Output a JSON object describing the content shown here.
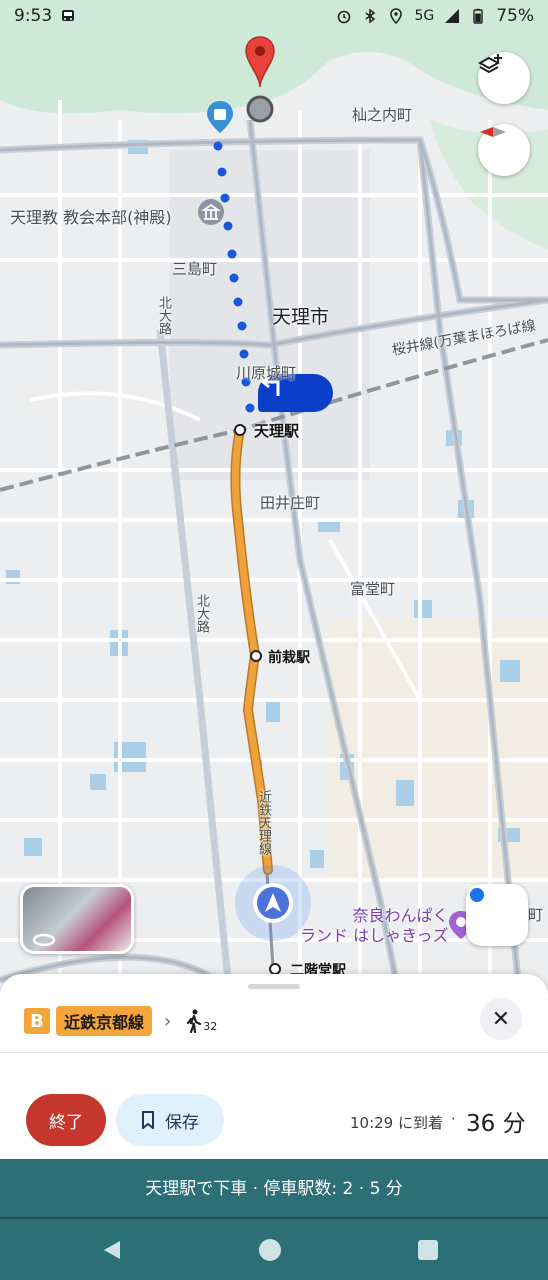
{
  "status_bar": {
    "time": "9:53",
    "network": "5G",
    "battery": "75%"
  },
  "map": {
    "labels": {
      "soma": "杣之内町",
      "tenrikyo": "天理教 教会本部(神殿)",
      "mishima": "三島町",
      "tenri_city": "天理市",
      "kitaoji_1": "北大路",
      "kawaharajo": "川原城町",
      "sakurai_line": "桜井線(万葉まほろば線",
      "tenri_station": "天理駅",
      "tainosho": "田井庄町",
      "tomido": "富堂町",
      "kitaoji_2": "北大路",
      "senzai_station": "前栽駅",
      "kintetsu_tenri_line": "近鉄天理線",
      "nara_wanpaku": "奈良わんぱく\nランド はしゃきっズ",
      "nikaido_station": "二階堂駅",
      "edge_cho": "町"
    }
  },
  "sheet": {
    "line_letter": "B",
    "line_name": "近鉄京都線",
    "walk_minutes": "32",
    "end_label": "終了",
    "save_label": "保存",
    "arrival": "10:29 に到着",
    "separator": "·",
    "duration": "36 分"
  },
  "instruction": "天理駅で下車 · 停車駅数: 2 · 5 分",
  "colors": {
    "route_orange": "#f0a23a",
    "walk_dots": "#1a56db",
    "turn_badge": "#0b3fc9",
    "instruction_bar": "#2d6f76",
    "end_button": "#c5372c"
  }
}
